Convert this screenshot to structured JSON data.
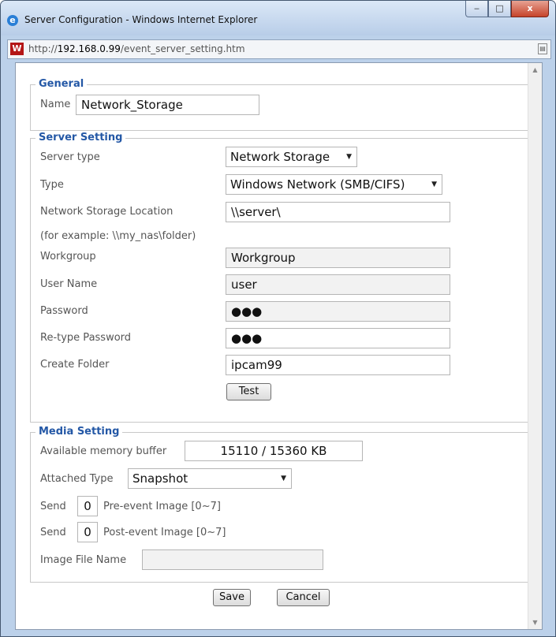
{
  "window": {
    "title": "Server Configuration - Windows Internet Explorer",
    "minimize_glyph": "‒",
    "maximize_glyph": "□",
    "close_glyph": "x"
  },
  "address": {
    "prefix": "http://",
    "host": "192.168.0.99",
    "path": "/event_server_setting.htm"
  },
  "general": {
    "legend": "General",
    "name_label": "Name",
    "name_value": "Network_Storage"
  },
  "server_setting": {
    "legend": "Server Setting",
    "server_type_label": "Server type",
    "server_type_value": "Network Storage",
    "type_label": "Type",
    "type_value": "Windows Network (SMB/CIFS)",
    "location_label": "Network Storage Location",
    "location_value": "\\\\server\\",
    "example_text": "(for example: \\\\my_nas\\folder)",
    "workgroup_label": "Workgroup",
    "workgroup_value": "Workgroup",
    "username_label": "User Name",
    "username_value": "user",
    "password_label": "Password",
    "password_value": "●●●",
    "retype_label": "Re-type Password",
    "retype_value": "●●●",
    "folder_label": "Create Folder",
    "folder_value": "ipcam99",
    "test_label": "Test"
  },
  "media_setting": {
    "legend": "Media Setting",
    "memory_label": "Available memory buffer",
    "memory_value": "15110 / 15360 KB",
    "attached_label": "Attached Type",
    "attached_value": "Snapshot",
    "send_label": "Send",
    "pre_value": "0",
    "pre_label": "Pre-event Image [0~7]",
    "post_value": "0",
    "post_label": "Post-event Image [0~7]",
    "filename_label": "Image File Name",
    "filename_value": ""
  },
  "buttons": {
    "save": "Save",
    "cancel": "Cancel"
  }
}
